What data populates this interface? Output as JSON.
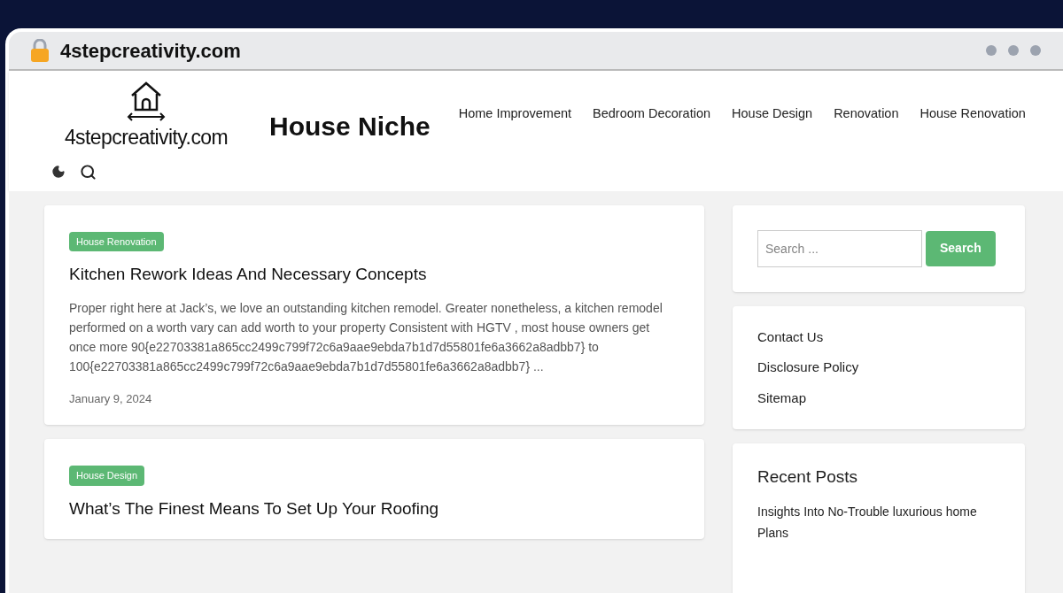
{
  "browser": {
    "address": "4stepcreativity.com"
  },
  "header": {
    "logo_text": "4stepcreativity.com",
    "site_title": "House Niche",
    "nav": [
      {
        "label": "Home Improvement"
      },
      {
        "label": "Bedroom Decoration"
      },
      {
        "label": "House Design"
      },
      {
        "label": "Renovation"
      },
      {
        "label": "House Renovation"
      }
    ]
  },
  "posts": [
    {
      "category": "House Renovation",
      "title": "Kitchen Rework Ideas And Necessary Concepts",
      "excerpt": "Proper right here at Jack’s, we love an outstanding kitchen remodel. Greater nonetheless, a kitchen remodel performed on a worth vary can add worth to your property Consistent with HGTV , most house owners get once more 90{e22703381a865cc2499c799f72c6a9aae9ebda7b1d7d55801fe6a3662a8adbb7} to 100{e22703381a865cc2499c799f72c6a9aae9ebda7b1d7d55801fe6a3662a8adbb7} ...",
      "date": "January 9, 2024"
    },
    {
      "category": "House Design",
      "title": "What’s The Finest Means To Set Up Your Roofing"
    }
  ],
  "sidebar": {
    "search": {
      "placeholder": "Search ...",
      "button": "Search"
    },
    "links": [
      "Contact Us",
      "Disclosure Policy",
      "Sitemap"
    ],
    "recent_posts": {
      "title": "Recent Posts",
      "items": [
        "Insights Into No-Trouble luxurious home Plans"
      ]
    }
  }
}
